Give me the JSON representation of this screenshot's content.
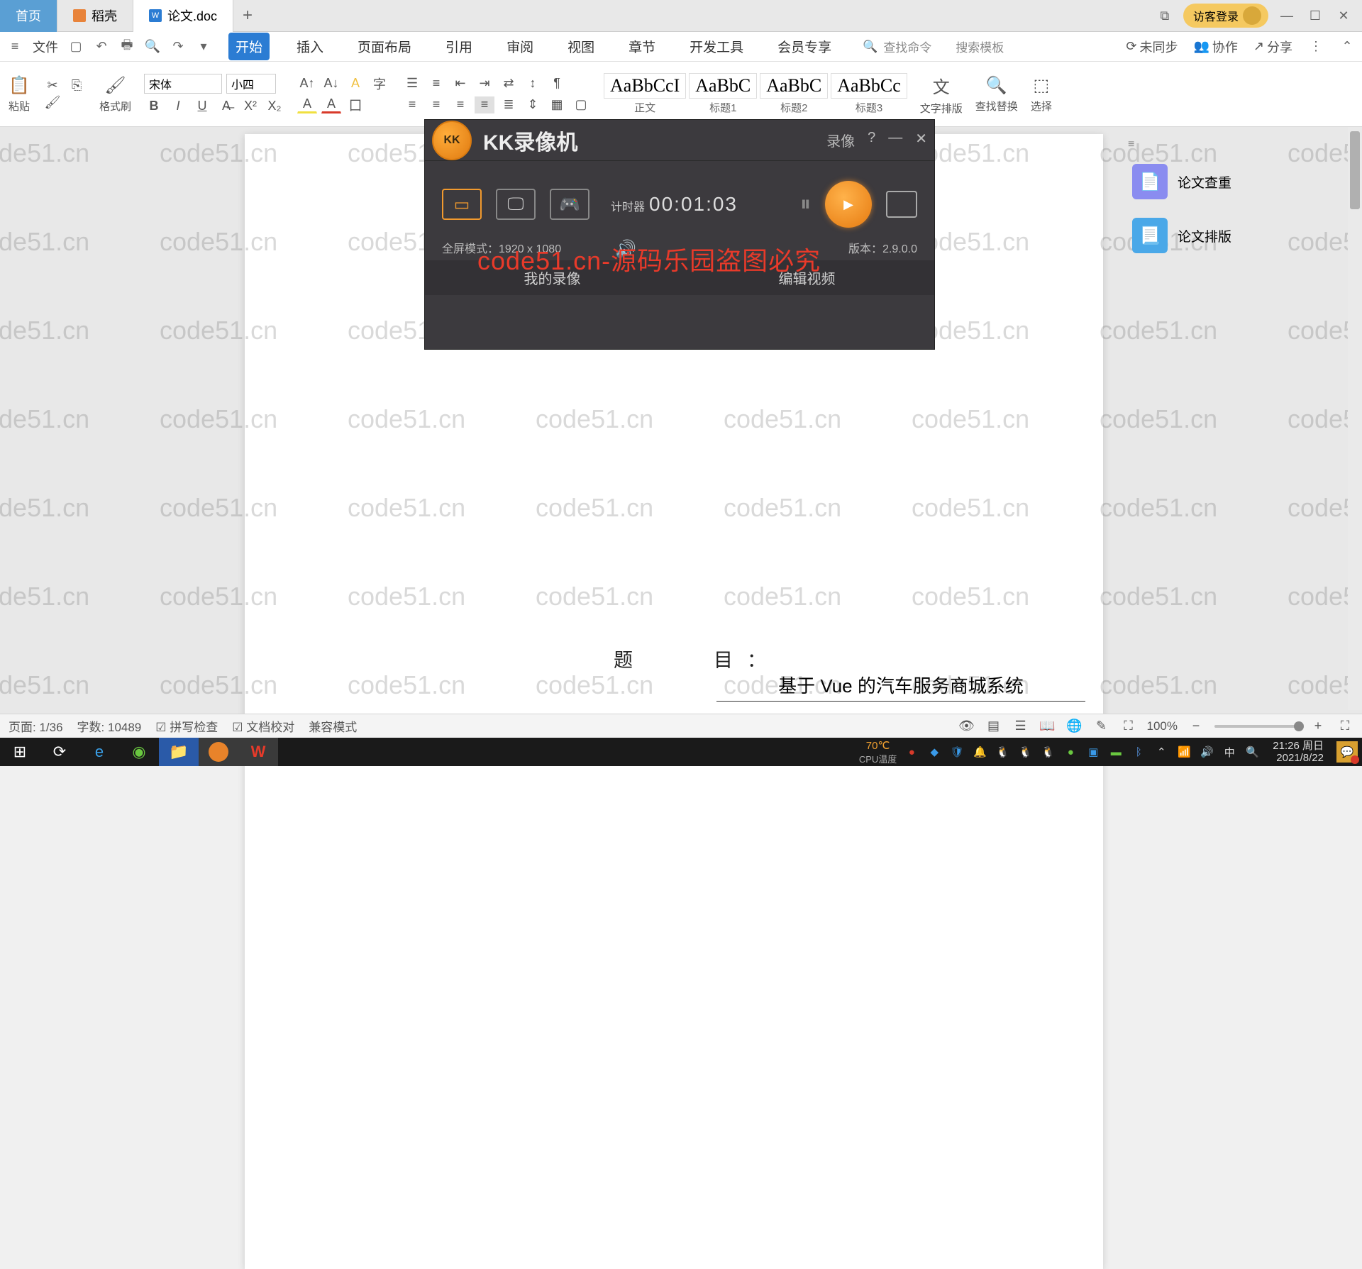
{
  "tabs": {
    "home": "首页",
    "t1": "稻壳",
    "t2": "论文.doc"
  },
  "login": "访客登录",
  "menubar": {
    "file": "文件",
    "items": [
      "开始",
      "插入",
      "页面布局",
      "引用",
      "审阅",
      "视图",
      "章节",
      "开发工具",
      "会员专享"
    ],
    "search_ph": "查找命令",
    "search_tpl": "搜索模板",
    "unsync": "未同步",
    "coop": "协作",
    "share": "分享"
  },
  "ribbon": {
    "paste": "粘贴",
    "format": "格式刷",
    "font": "宋体",
    "size": "小四",
    "styles": [
      "AaBbCcI",
      "AaBbC",
      "AaBbC",
      "AaBbCc"
    ],
    "style_lbls": [
      "正文",
      "标题1",
      "标题2",
      "标题3"
    ],
    "r1": "文字排版",
    "r2": "查找替换",
    "r3": "选择"
  },
  "rpanel": {
    "a": "论文查重",
    "b": "论文排版"
  },
  "doc": {
    "label": "题　　目：",
    "value": "基于 Vue 的汽车服务商城系统"
  },
  "recorder": {
    "title": "KK录像机",
    "tag": "计时器",
    "timer": "00:01:03",
    "res_lbl": "全屏模式：",
    "res": "1920 x 1080",
    "ver_lbl": "版本：",
    "ver": "2.9.0.0",
    "tab1": "我的录像",
    "tab2": "编辑视频",
    "red": "code51.cn-源码乐园盗图必究",
    "top1": "录像",
    "top2": "?"
  },
  "status": {
    "page": "页面: 1/36",
    "words": "字数: 10489",
    "spell": "拼写检查",
    "proof": "文档校对",
    "compat": "兼容模式",
    "zoom": "100%"
  },
  "taskbar": {
    "temp": "70℃",
    "temp_lbl": "CPU温度",
    "time": "21:26 周日",
    "date": "2021/8/22",
    "ime": "中"
  },
  "watermark": "code51.cn"
}
